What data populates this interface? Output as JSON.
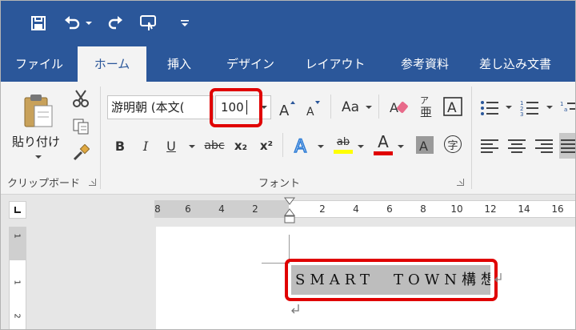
{
  "tabs": [
    "ファイル",
    "ホーム",
    "挿入",
    "デザイン",
    "レイアウト",
    "参考資料",
    "差し込み文書"
  ],
  "active_tab_index": 1,
  "clipboard": {
    "paste_label": "貼り付け",
    "group_label": "クリップボード"
  },
  "font": {
    "font_name": "游明朝 (本文(",
    "font_size": "100",
    "change_case_label": "Aa",
    "bold": "B",
    "italic": "I",
    "underline": "U",
    "strikethrough": "abc",
    "subscript": "x₂",
    "superscript": "x²",
    "font_color_letter": "A",
    "highlight_letters": "ab",
    "phonetic_char": "字",
    "group_label": "フォント",
    "highlight_color": "#ffff00",
    "font_color": "#e00000"
  },
  "ruler": {
    "labels": [
      "8",
      "6",
      "4",
      "2",
      "2",
      "4",
      "6",
      "8",
      "10",
      "12",
      "14",
      "16"
    ],
    "vertical_labels": [
      "1",
      "1",
      "2"
    ]
  },
  "document": {
    "selected_text": "SMART　TOWN構想"
  },
  "colors": {
    "ribbon_blue": "#2b579a",
    "callout_red": "#e00000"
  }
}
